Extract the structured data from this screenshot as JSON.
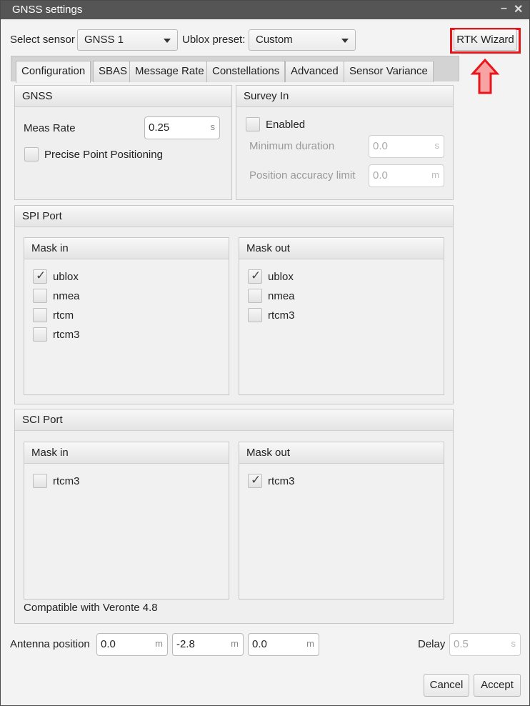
{
  "window": {
    "title": "GNSS settings",
    "minimize_glyph": "–",
    "close_glyph": "✕"
  },
  "top": {
    "select_sensor_label": "Select sensor",
    "sensor_value": "GNSS 1",
    "ublox_preset_label": "Ublox preset:",
    "preset_value": "Custom",
    "rtk_wizard_label": "RTK Wizard",
    "highlight_color": "#e8151b"
  },
  "tabs": [
    {
      "label": "Configuration",
      "active": true
    },
    {
      "label": "SBAS"
    },
    {
      "label": "Message Rate"
    },
    {
      "label": "Constellations"
    },
    {
      "label": "Advanced"
    },
    {
      "label": "Sensor Variance"
    }
  ],
  "gnss": {
    "header": "GNSS",
    "meas_rate_label": "Meas Rate",
    "meas_rate_value": "0.25",
    "meas_rate_unit": "s",
    "ppp_label": "Precise Point Positioning"
  },
  "survey_in": {
    "header": "Survey In",
    "enabled_label": "Enabled",
    "min_duration_label": "Minimum duration",
    "min_duration_value": "0.0",
    "min_duration_unit": "s",
    "pos_acc_label": "Position accuracy limit",
    "pos_acc_value": "0.0",
    "pos_acc_unit": "m"
  },
  "spi_port": {
    "header": "SPI Port",
    "mask_in": {
      "header": "Mask in",
      "items": [
        {
          "label": "ublox",
          "checked": true
        },
        {
          "label": "nmea",
          "checked": false
        },
        {
          "label": "rtcm",
          "checked": false
        },
        {
          "label": "rtcm3",
          "checked": false
        }
      ]
    },
    "mask_out": {
      "header": "Mask out",
      "items": [
        {
          "label": "ublox",
          "checked": true
        },
        {
          "label": "nmea",
          "checked": false
        },
        {
          "label": "rtcm3",
          "checked": false
        }
      ]
    }
  },
  "sci_port": {
    "header": "SCI Port",
    "mask_in": {
      "header": "Mask in",
      "items": [
        {
          "label": "rtcm3",
          "checked": false
        }
      ]
    },
    "mask_out": {
      "header": "Mask out",
      "items": [
        {
          "label": "rtcm3",
          "checked": true
        }
      ]
    },
    "compat_note": "Compatible with Veronte 4.8"
  },
  "bottom": {
    "antenna_label": "Antenna position",
    "antenna": [
      {
        "value": "0.0",
        "unit": "m"
      },
      {
        "value": "-2.8",
        "unit": "m"
      },
      {
        "value": "0.0",
        "unit": "m"
      }
    ],
    "delay_label": "Delay",
    "delay_value": "0.5",
    "delay_unit": "s",
    "cancel_label": "Cancel",
    "accept_label": "Accept",
    "check_glyph": "✓"
  }
}
